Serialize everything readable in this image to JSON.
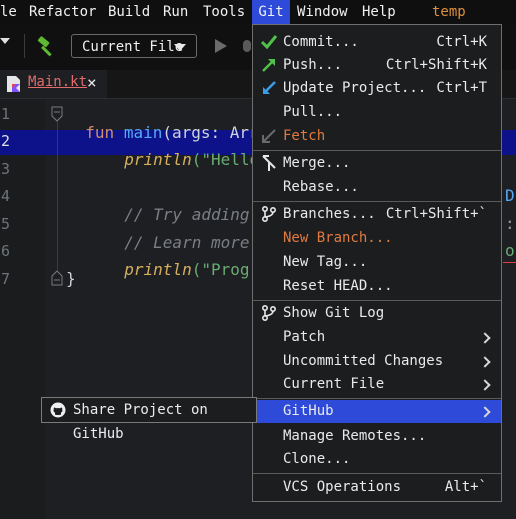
{
  "menubar": {
    "items": [
      "le",
      "Refactor",
      "Build",
      "Run",
      "Tools",
      "Git",
      "Window",
      "Help"
    ],
    "project": "temp"
  },
  "toolbar": {
    "run_config": "Current File"
  },
  "editor": {
    "tab": {
      "name": "Main.kt",
      "close": "×"
    },
    "line_numbers": [
      "1",
      "2",
      "3",
      "4",
      "5",
      "6",
      "7"
    ],
    "code": {
      "l1_kw": "fun",
      "l1_fn": "main",
      "l1_rest": "(args: Arra",
      "l2_call": "println",
      "l2_str": "(\"Hello",
      "l4_cmt": "// Try adding p",
      "l4_tail": "D",
      "l5_cmt": "// Learn more a",
      "l5_tail": ":",
      "l6_call": "println",
      "l6_str": "(\"Progra",
      "l6_tail": "o",
      "l7": "}"
    }
  },
  "git_menu": {
    "items": [
      {
        "label": "Commit...",
        "shortcut": "Ctrl+K",
        "icon": "check-icon"
      },
      {
        "label": "Push...",
        "shortcut": "Ctrl+Shift+K",
        "icon": "push-arrow-icon"
      },
      {
        "label": "Update Project...",
        "shortcut": "Ctrl+T",
        "icon": "update-arrow-icon"
      },
      {
        "label": "Pull...",
        "shortcut": ""
      },
      {
        "label": "Fetch",
        "shortcut": "",
        "icon": "fetch-icon"
      },
      {
        "label": "Merge...",
        "shortcut": "",
        "icon": "merge-icon"
      },
      {
        "label": "Rebase...",
        "shortcut": ""
      },
      {
        "label": "Branches...",
        "shortcut": "Ctrl+Shift+`",
        "icon": "branch-icon"
      },
      {
        "label": "New Branch...",
        "shortcut": ""
      },
      {
        "label": "New Tag...",
        "shortcut": ""
      },
      {
        "label": "Reset HEAD...",
        "shortcut": ""
      },
      {
        "label": "Show Git Log",
        "shortcut": "",
        "icon": "git-log-icon"
      },
      {
        "label": "Patch",
        "shortcut": ""
      },
      {
        "label": "Uncommitted Changes",
        "shortcut": ""
      },
      {
        "label": "Current File",
        "shortcut": ""
      },
      {
        "label": "GitHub",
        "shortcut": ""
      },
      {
        "label": "Manage Remotes...",
        "shortcut": ""
      },
      {
        "label": "Clone...",
        "shortcut": ""
      },
      {
        "label": "VCS Operations",
        "shortcut": "Alt+`"
      }
    ]
  },
  "github_submenu": {
    "item": "Share Project on GitHub",
    "icon": "github-icon"
  },
  "colors": {
    "accent": "#2d4ad8",
    "dimmed_item": "#e07a3f",
    "line_highlight": "#0d128a"
  }
}
